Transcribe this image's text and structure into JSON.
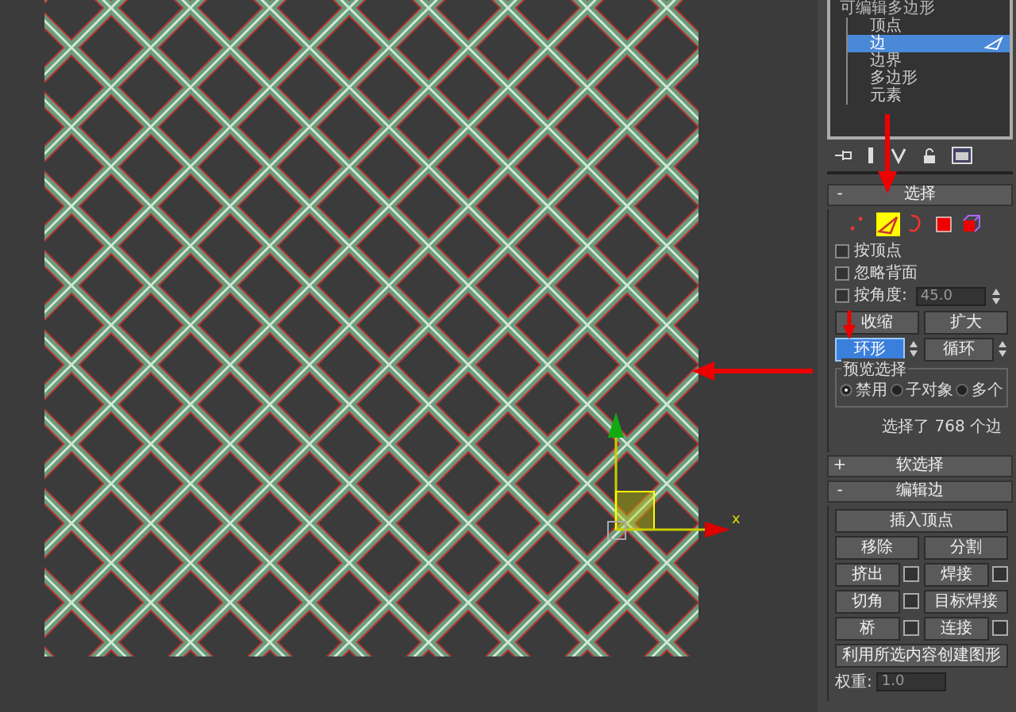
{
  "viewport": {
    "axis_label": "x"
  },
  "modifier_stack": {
    "title": "可编辑多边形",
    "children": [
      {
        "label": "顶点",
        "selected": false
      },
      {
        "label": "边",
        "selected": true
      },
      {
        "label": "边界",
        "selected": false
      },
      {
        "label": "多边形",
        "selected": false
      },
      {
        "label": "元素",
        "selected": false
      }
    ]
  },
  "selection_rollout": {
    "toggle": "-",
    "title": "选择",
    "subobject_modes": [
      {
        "kind": "vertex",
        "selected": false
      },
      {
        "kind": "edge",
        "selected": true
      },
      {
        "kind": "border",
        "selected": false
      },
      {
        "kind": "polygon",
        "selected": false
      },
      {
        "kind": "element",
        "selected": false
      }
    ],
    "checkboxes": [
      {
        "label": "按顶点",
        "checked": false
      },
      {
        "label": "忽略背面",
        "checked": false
      },
      {
        "label": "按角度:",
        "checked": false,
        "value": "45.0"
      }
    ],
    "button_rows": [
      [
        {
          "label": "收缩",
          "spinner": false,
          "selected": false
        },
        {
          "label": "扩大",
          "spinner": false,
          "selected": false
        }
      ],
      [
        {
          "label": "环形",
          "spinner": true,
          "selected": true
        },
        {
          "label": "循环",
          "spinner": true,
          "selected": false
        }
      ]
    ],
    "preview": {
      "title": "预览选择",
      "options": [
        {
          "label": "禁用",
          "selected": true
        },
        {
          "label": "子对象",
          "selected": false
        },
        {
          "label": "多个",
          "selected": false
        }
      ]
    },
    "status": "选择了 768 个边"
  },
  "soft_selection_rollout": {
    "toggle": "+",
    "title": "软选择"
  },
  "edit_edges_rollout": {
    "toggle": "-",
    "title": "编辑边",
    "rows": [
      [
        {
          "label": "插入顶点",
          "settings": false
        }
      ],
      [
        {
          "label": "移除",
          "settings": false
        },
        {
          "label": "分割",
          "settings": false
        }
      ],
      [
        {
          "label": "挤出",
          "settings": true
        },
        {
          "label": "焊接",
          "settings": true
        }
      ],
      [
        {
          "label": "切角",
          "settings": true
        },
        {
          "label": "目标焊接",
          "settings": false
        }
      ],
      [
        {
          "label": "桥",
          "settings": true
        },
        {
          "label": "连接",
          "settings": true
        }
      ],
      [
        {
          "label": "利用所选内容创建图形",
          "settings": false
        }
      ]
    ],
    "weight": {
      "label": "权重:",
      "value": "1.0"
    }
  }
}
